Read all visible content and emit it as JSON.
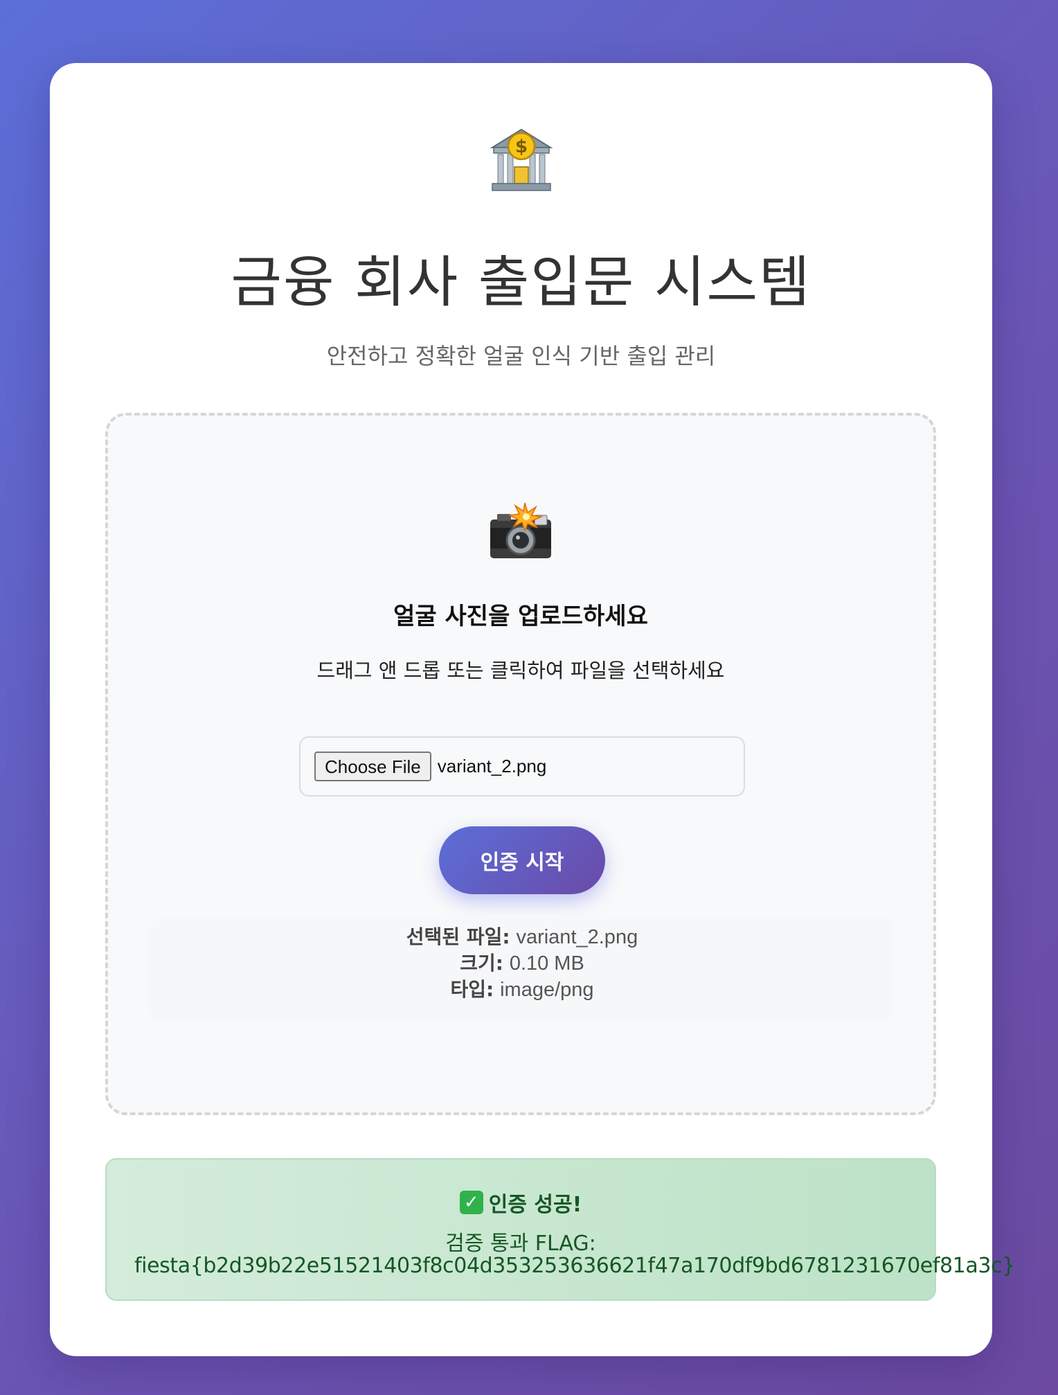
{
  "header": {
    "logo_icon": "bank-icon",
    "title": "금융 회사 출입문 시스템",
    "subtitle": "안전하고 정확한 얼굴 인식 기반 출입 관리"
  },
  "upload": {
    "icon": "camera-flash-icon",
    "title": "얼굴 사진을 업로드하세요",
    "hint": "드래그 앤 드롭 또는 클릭하여 파일을 선택하세요",
    "choose_file_label": "Choose File",
    "file_name": "variant_2.png",
    "submit_label": "인증 시작"
  },
  "file_info": {
    "name_label": "선택된 파일:",
    "name_value": "variant_2.png",
    "size_label": "크기:",
    "size_value": "0.10 MB",
    "type_label": "타입:",
    "type_value": "image/png"
  },
  "result": {
    "icon": "check-mark-icon",
    "check_glyph": "✓",
    "heading": "인증 성공!",
    "line": "검증 통과 FLAG:",
    "flag": "fiesta{b2d39b22e51521403f8c04d353253636621f47a170df9bd6781231670ef81a3c}"
  },
  "colors": {
    "background_start": "#5b6fd8",
    "background_end": "#6b4aa0",
    "success_bg": "#c8e8d2",
    "success_text": "#155724"
  }
}
